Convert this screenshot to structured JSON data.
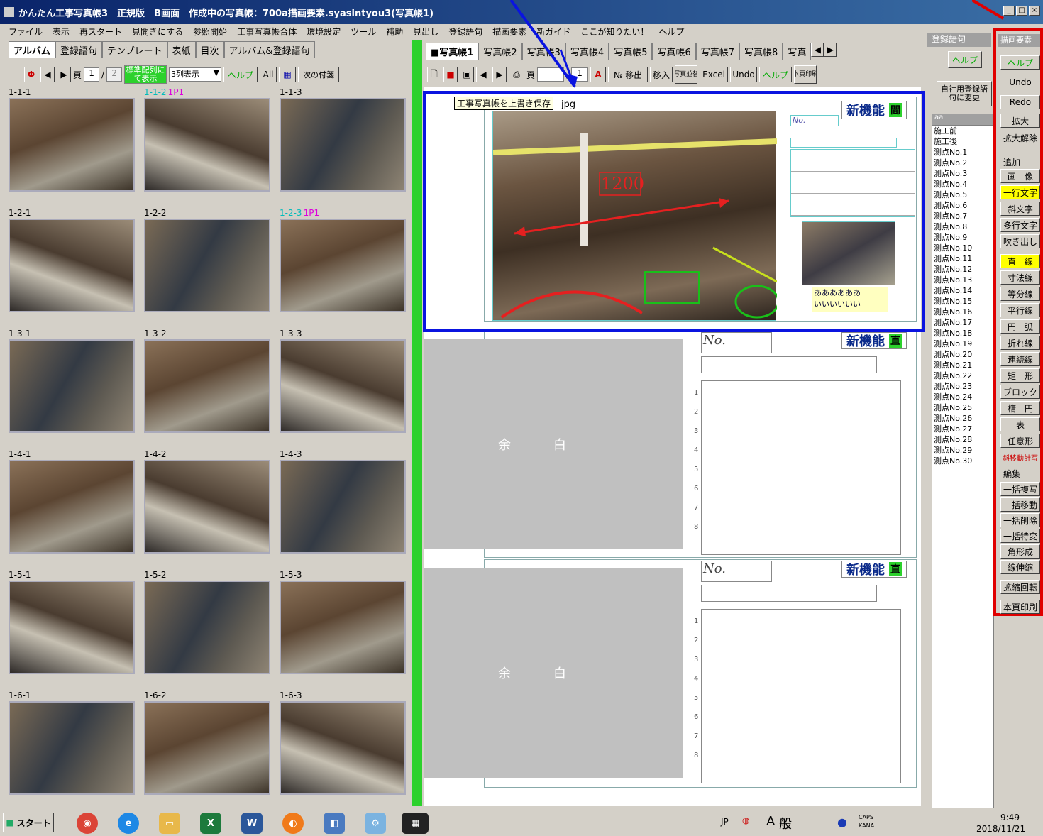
{
  "window": {
    "title": "かんたん工事写真帳3　正規版　B画面　作成中の写真帳：700a描画要素.syasintyou3(写真帳1)",
    "min": "_",
    "max": "□",
    "close": "×"
  },
  "menu": [
    "ファイル",
    "表示",
    "再スタート",
    "見開きにする",
    "参照開始",
    "工事写真帳合体",
    "環境設定",
    "ツール",
    "補助",
    "見出し",
    "登録語句",
    "描画要素",
    "新ガイド",
    "ここが知りたい！",
    "ヘルプ"
  ],
  "left": {
    "tabs": [
      "アルバム",
      "登録語句",
      "テンプレート",
      "表紙",
      "目次",
      "アルバム&登録語句"
    ],
    "toolbar": {
      "page_label": "頁",
      "page_value": "1",
      "page_sep": "/",
      "page_total": "2",
      "std_btn": "標準配列にて表示",
      "cols_select": "3列表示",
      "help": "ヘルプ",
      "all": "All",
      "next_attach": "次の付箋"
    },
    "thumbs": [
      {
        "label": "1-1-1",
        "p1": ""
      },
      {
        "label": "1-1-2",
        "p1": "1P1"
      },
      {
        "label": "1-1-3",
        "p1": ""
      },
      {
        "label": "1-2-1",
        "p1": ""
      },
      {
        "label": "1-2-2",
        "p1": ""
      },
      {
        "label": "1-2-3",
        "p1": "1P1"
      },
      {
        "label": "1-3-1",
        "p1": ""
      },
      {
        "label": "1-3-2",
        "p1": ""
      },
      {
        "label": "1-3-3",
        "p1": ""
      },
      {
        "label": "1-4-1",
        "p1": ""
      },
      {
        "label": "1-4-2",
        "p1": ""
      },
      {
        "label": "1-4-3",
        "p1": ""
      },
      {
        "label": "1-5-1",
        "p1": ""
      },
      {
        "label": "1-5-2",
        "p1": ""
      },
      {
        "label": "1-5-3",
        "p1": ""
      },
      {
        "label": "1-6-1",
        "p1": ""
      },
      {
        "label": "1-6-2",
        "p1": ""
      },
      {
        "label": "1-6-3",
        "p1": ""
      }
    ]
  },
  "center": {
    "tabs": [
      "■写真帳1",
      "写真帳2",
      "写真帳3",
      "写真帳4",
      "写真帳5",
      "写真帳6",
      "写真帳7",
      "写真帳8",
      "写真"
    ],
    "toolbar": {
      "page_label": "頁",
      "page_sep": "/",
      "page_total": "1",
      "no_move": "№ 移出",
      "move_in": "移入",
      "photo_arrange": "写真並替",
      "excel": "Excel",
      "undo": "Undo",
      "help": "ヘルプ",
      "this_page_print": "本頁印刷"
    },
    "tooltip": "工事写真帳を上書き保存",
    "filename_suffix": "jpg",
    "new_feature": "新機能",
    "new_feature_tag": "間",
    "new_feature_tag2": "直",
    "no_label": "No.",
    "dimension": "1200",
    "callout": [
      "ああああああ",
      "いいいいいい"
    ],
    "blank": "余白",
    "line_numbers": [
      "1",
      "2",
      "3",
      "4",
      "5",
      "6",
      "7",
      "8"
    ]
  },
  "registry": {
    "title": "登録語句",
    "help": "ヘルプ",
    "change": "自社用登録語句に変更",
    "list_header": "aa",
    "items": [
      "施工前",
      "施工後",
      "測点No.1",
      "測点No.2",
      "測点No.3",
      "測点No.4",
      "測点No.5",
      "測点No.6",
      "測点No.7",
      "測点No.8",
      "測点No.9",
      "測点No.10",
      "測点No.11",
      "測点No.12",
      "測点No.13",
      "測点No.14",
      "測点No.15",
      "測点No.16",
      "測点No.17",
      "測点No.18",
      "測点No.19",
      "測点No.20",
      "測点No.21",
      "測点No.22",
      "測点No.23",
      "測点No.24",
      "測点No.25",
      "測点No.26",
      "測点No.27",
      "測点No.28",
      "測点No.29",
      "測点No.30"
    ]
  },
  "draw": {
    "title": "描画要素",
    "help": "ヘルプ",
    "undo": "Undo",
    "redo": "Redo",
    "zoom": "拡大",
    "zoom_off": "拡大解除",
    "add_group": "追加",
    "buttons": [
      "画　像",
      "一行文字",
      "斜文字",
      "多行文字",
      "吹き出し",
      "直　線",
      "寸法線",
      "等分線",
      "平行線",
      "円　弧",
      "折れ線",
      "連続線",
      "矩　形",
      "ブロック",
      "楕　円",
      "表",
      "任意形",
      "斜移動計写"
    ],
    "edit_group": "編集",
    "edit_buttons": [
      "一括複写",
      "一括移動",
      "一括削除",
      "一括特変",
      "角形成",
      "線伸縮",
      "拡縮回転",
      "本頁印刷"
    ]
  },
  "taskbar": {
    "start": "スタート",
    "ime_jp": "JP",
    "ime_a": "A",
    "ime_mode": "般",
    "caps": "CAPS",
    "kana": "KANA",
    "time": "9:49",
    "date": "2018/11/21"
  },
  "colors": {
    "highlight_blue": "#0a14e0",
    "highlight_red": "#e00000",
    "green_bar": "#2cd12c",
    "new_feature_text": "#0a2a8a"
  }
}
